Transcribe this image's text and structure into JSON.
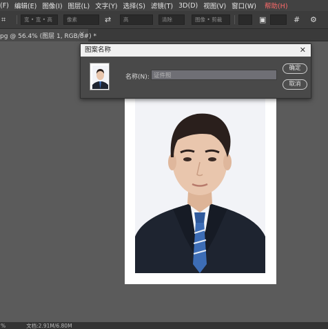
{
  "menubar": {
    "items": [
      "(F)",
      "编辑(E)",
      "图像(I)",
      "图层(L)",
      "文字(Y)",
      "选择(S)",
      "滤镜(T)",
      "3D(D)",
      "视图(V)",
      "窗口(W)"
    ],
    "help": "帮助(H)"
  },
  "optbar": {
    "field1": "宽 • 宽 • 高",
    "field2": "像素",
    "field3": "高",
    "field4": "清除",
    "field5": "图像 • 剪裁"
  },
  "tab": {
    "title": "pg @ 56.4% (图层 1, RGB/8#) *",
    "close": "×"
  },
  "dialog": {
    "title": "图案名称",
    "close": "✕",
    "name_label": "名称(N):",
    "name_value": "证件照",
    "ok": "确定",
    "cancel": "取消"
  },
  "status": {
    "zoom": "%",
    "doc": "文档:2.91M/6.80M"
  },
  "colors": {
    "suit": "#1e2430",
    "tie": "#3d6db5",
    "skin": "#e9c6ad",
    "hair": "#2a1f1c",
    "bg": "#f2f3f7"
  }
}
